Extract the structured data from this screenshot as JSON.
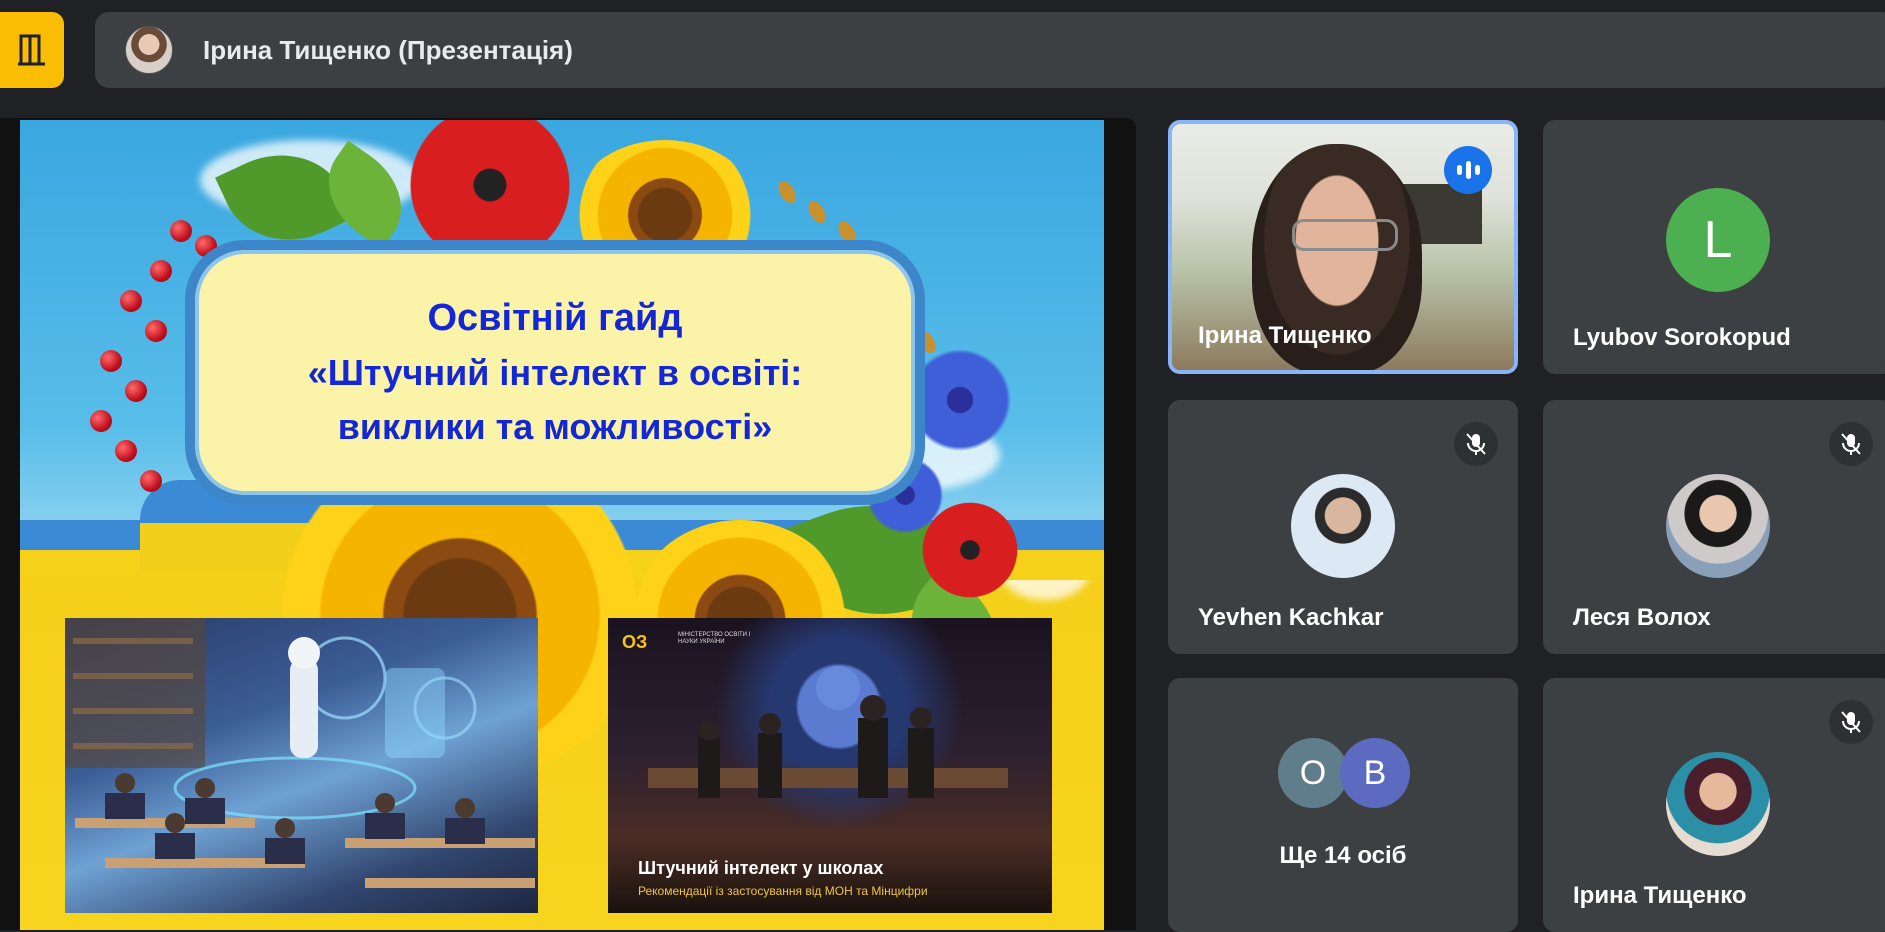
{
  "header": {
    "presenter_title": "Ірина Тищенко (Презентація)",
    "exit_icon": "door-exit-icon",
    "accent_color": "#fbbc04"
  },
  "slide": {
    "title_line1": "Освітній гайд",
    "title_line2": "«Штучний інтелект в освіті:",
    "title_line3": "виклики та можливості»",
    "right_image": {
      "brand_logo": "ОЗ",
      "brand_text": "МІНІСТЕРСТВО ОСВІТИ І НАУКИ УКРАЇНИ",
      "caption_title": "Штучний інтелект у школах",
      "caption_sub": "Рекомендації із застосування від МОН та Мінцифри"
    }
  },
  "participants": [
    {
      "name": "Ірина Тищенко",
      "state": "speaking",
      "icon": "speaking-indicator-icon"
    },
    {
      "name": "Lyubov Sorokopud",
      "avatar_letter": "L",
      "avatar_color": "#4caf50"
    },
    {
      "name": "Yevhen Kachkar",
      "state": "muted",
      "icon": "mic-off-icon"
    },
    {
      "name": "Леся Волох",
      "state": "muted",
      "icon": "mic-off-icon"
    },
    {
      "more_label": "Ще 14 осіб",
      "avatars": [
        {
          "letter": "O",
          "color": "#607d8b"
        },
        {
          "letter": "B",
          "color": "#5c6bc0"
        }
      ]
    },
    {
      "name": "Ірина Тищенко",
      "state": "muted",
      "icon": "mic-off-icon"
    }
  ]
}
